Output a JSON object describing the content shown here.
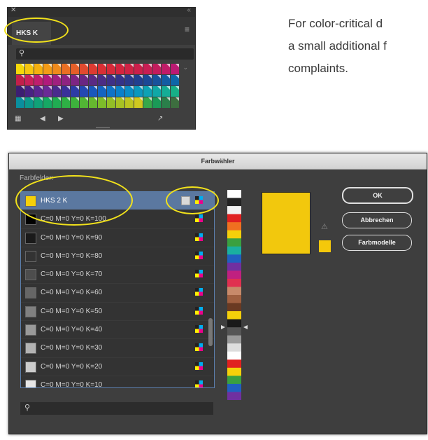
{
  "swatches_panel": {
    "tab_label": "HKS K",
    "colors": {
      "row1": [
        "#f5d90a",
        "#f7c60f",
        "#f5b00f",
        "#f39b16",
        "#ef8a1c",
        "#ea6f23",
        "#e55f29",
        "#e14a2f",
        "#dc3b32",
        "#d92f35",
        "#d62a3a",
        "#d3243f",
        "#cf2245",
        "#cb1f4b",
        "#c81e54",
        "#c31c5d",
        "#c01b68",
        "#bb1a73"
      ],
      "row2": [
        "#c21f4b",
        "#c9205a",
        "#bf1e6e",
        "#b11a7c",
        "#a0207f",
        "#8e2381",
        "#7d2583",
        "#6a2683",
        "#5a2a84",
        "#4b2d85",
        "#3e3087",
        "#343389",
        "#2a3a8c",
        "#223f90",
        "#1c4896",
        "#18529c",
        "#135ca3",
        "#0e66a8"
      ],
      "row3": [
        "#3c1f72",
        "#482383",
        "#5a2690",
        "#6b2a96",
        "#4a2b8d",
        "#3a309a",
        "#2d3ba6",
        "#2448b2",
        "#1a57bb",
        "#1464c2",
        "#0f73c7",
        "#0a80c9",
        "#0a8dc6",
        "#0b98bf",
        "#0da2b5",
        "#10a8a7",
        "#14ad96",
        "#17b086"
      ],
      "row4": [
        "#0a8f9e",
        "#0c9a8c",
        "#10a278",
        "#16a864",
        "#20ac52",
        "#2eb045",
        "#3db23c",
        "#52b535",
        "#66b82f",
        "#7dbb2a",
        "#93be26",
        "#a8c223",
        "#bcc521",
        "#cfc820",
        "#36a84a",
        "#1a9a57",
        "#2a7f4a",
        "#3d6e3f"
      ]
    },
    "scroll_glyph": "⌄"
  },
  "body_text": {
    "lines": [
      "For color-critical d",
      "a small additional f",
      "complaints."
    ]
  },
  "dialog": {
    "title": "Farbwähler",
    "list_label": "Farbfelder:",
    "rows": [
      {
        "swatch": "#f5d00a",
        "label": "HKS 2 K",
        "selected": true
      },
      {
        "swatch": "#000000",
        "label": "C=0 M=0 Y=0 K=100"
      },
      {
        "swatch": "#1a1a1a",
        "label": "C=0 M=0 Y=0 K=90"
      },
      {
        "swatch": "#333333",
        "label": "C=0 M=0 Y=0 K=80"
      },
      {
        "swatch": "#4d4d4d",
        "label": "C=0 M=0 Y=0 K=70"
      },
      {
        "swatch": "#666666",
        "label": "C=0 M=0 Y=0 K=60"
      },
      {
        "swatch": "#808080",
        "label": "C=0 M=0 Y=0 K=50"
      },
      {
        "swatch": "#999999",
        "label": "C=0 M=0 Y=0 K=40"
      },
      {
        "swatch": "#b3b3b3",
        "label": "C=0 M=0 Y=0 K=30"
      },
      {
        "swatch": "#cccccc",
        "label": "C=0 M=0 Y=0 K=20"
      },
      {
        "swatch": "#e6e6e6",
        "label": "C=0 M=0 Y=0 K=10"
      }
    ],
    "buttons": {
      "ok": "OK",
      "cancel": "Abbrechen",
      "color_models": "Farbmodelle"
    },
    "preview_color": "#f2c80d",
    "accent_color": "#5b78a0",
    "highlight_color": "#f2e21b"
  }
}
